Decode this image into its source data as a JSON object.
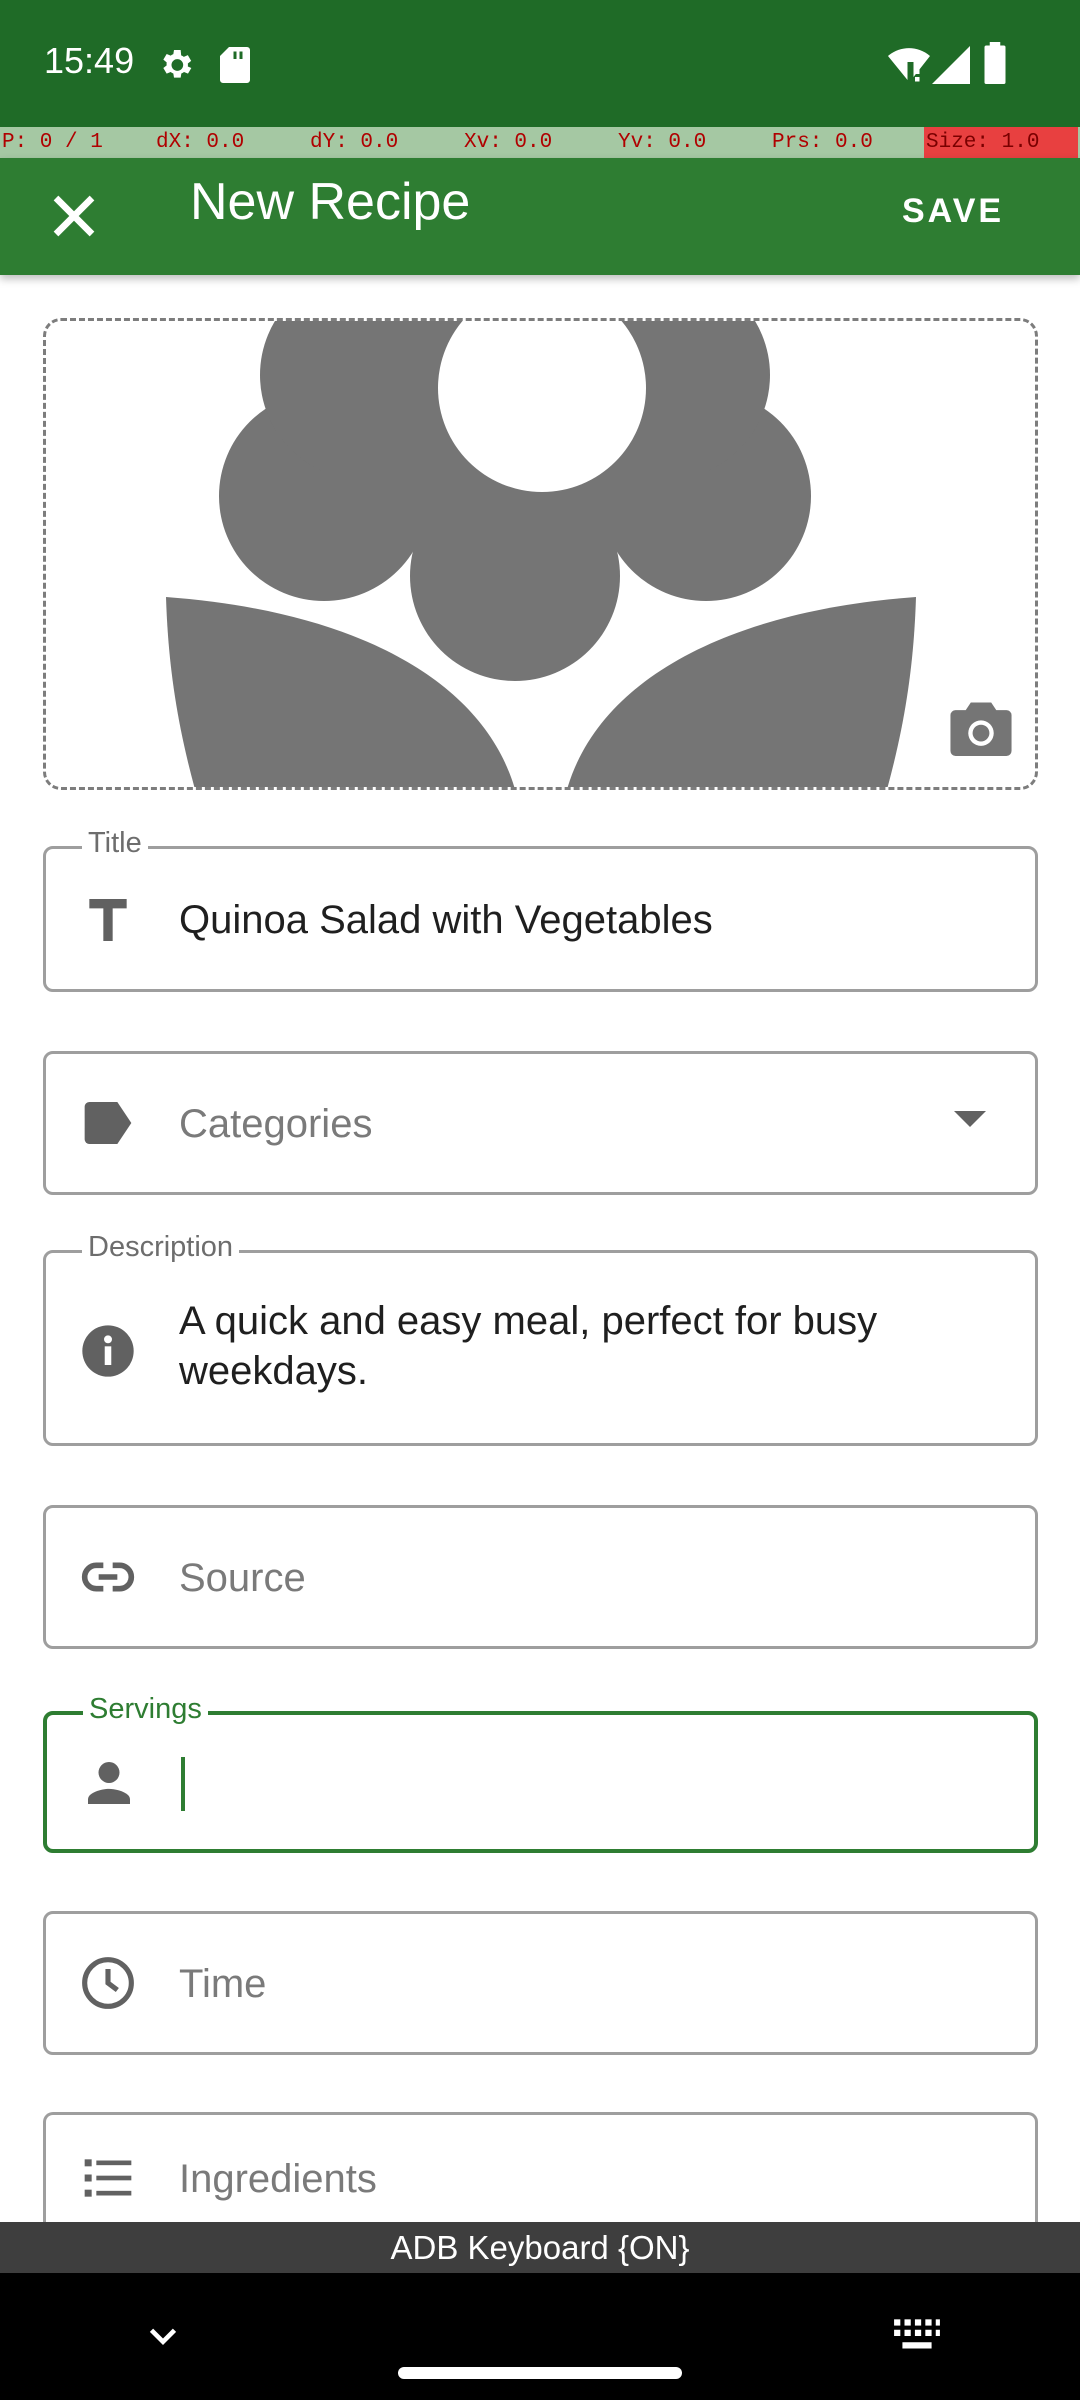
{
  "status_bar": {
    "time": "15:49",
    "icons": [
      "settings-icon",
      "sd-card-icon",
      "wifi-icon",
      "signal-icon",
      "battery-icon"
    ]
  },
  "pointer_overlay": {
    "p": "P: 0 / 1",
    "dx": "dX: 0.0",
    "dy": "dY: 0.0",
    "xv": "Xv: 0.0",
    "yv": "Yv: 0.0",
    "prs": "Prs: 0.0",
    "size": "Size: 1.0"
  },
  "app_bar": {
    "title": "New Recipe",
    "save_label": "SAVE",
    "close_icon": "close-icon"
  },
  "image": {
    "placeholder_icon": "flower-icon",
    "camera_icon": "camera-icon"
  },
  "fields": {
    "title": {
      "legend": "Title",
      "value": "Quinoa Salad with Vegetables",
      "icon": "text-icon"
    },
    "categories": {
      "placeholder": "Categories",
      "icon": "label-icon"
    },
    "description": {
      "legend": "Description",
      "value_line1": "A quick and easy meal, perfect for busy",
      "value_line2": "weekdays.",
      "icon": "info-icon"
    },
    "source": {
      "placeholder": "Source",
      "icon": "link-icon"
    },
    "servings": {
      "legend": "Servings",
      "value": "",
      "icon": "person-icon"
    },
    "time": {
      "placeholder": "Time",
      "icon": "clock-icon"
    },
    "ingredients": {
      "placeholder": "Ingredients",
      "icon": "list-icon"
    }
  },
  "keyboard_banner": "ADB Keyboard {ON}",
  "colors": {
    "status_bar": "#1f6b27",
    "app_bar": "#2e7d32",
    "accent": "#2e7d32",
    "outline": "#9e9e9e"
  }
}
